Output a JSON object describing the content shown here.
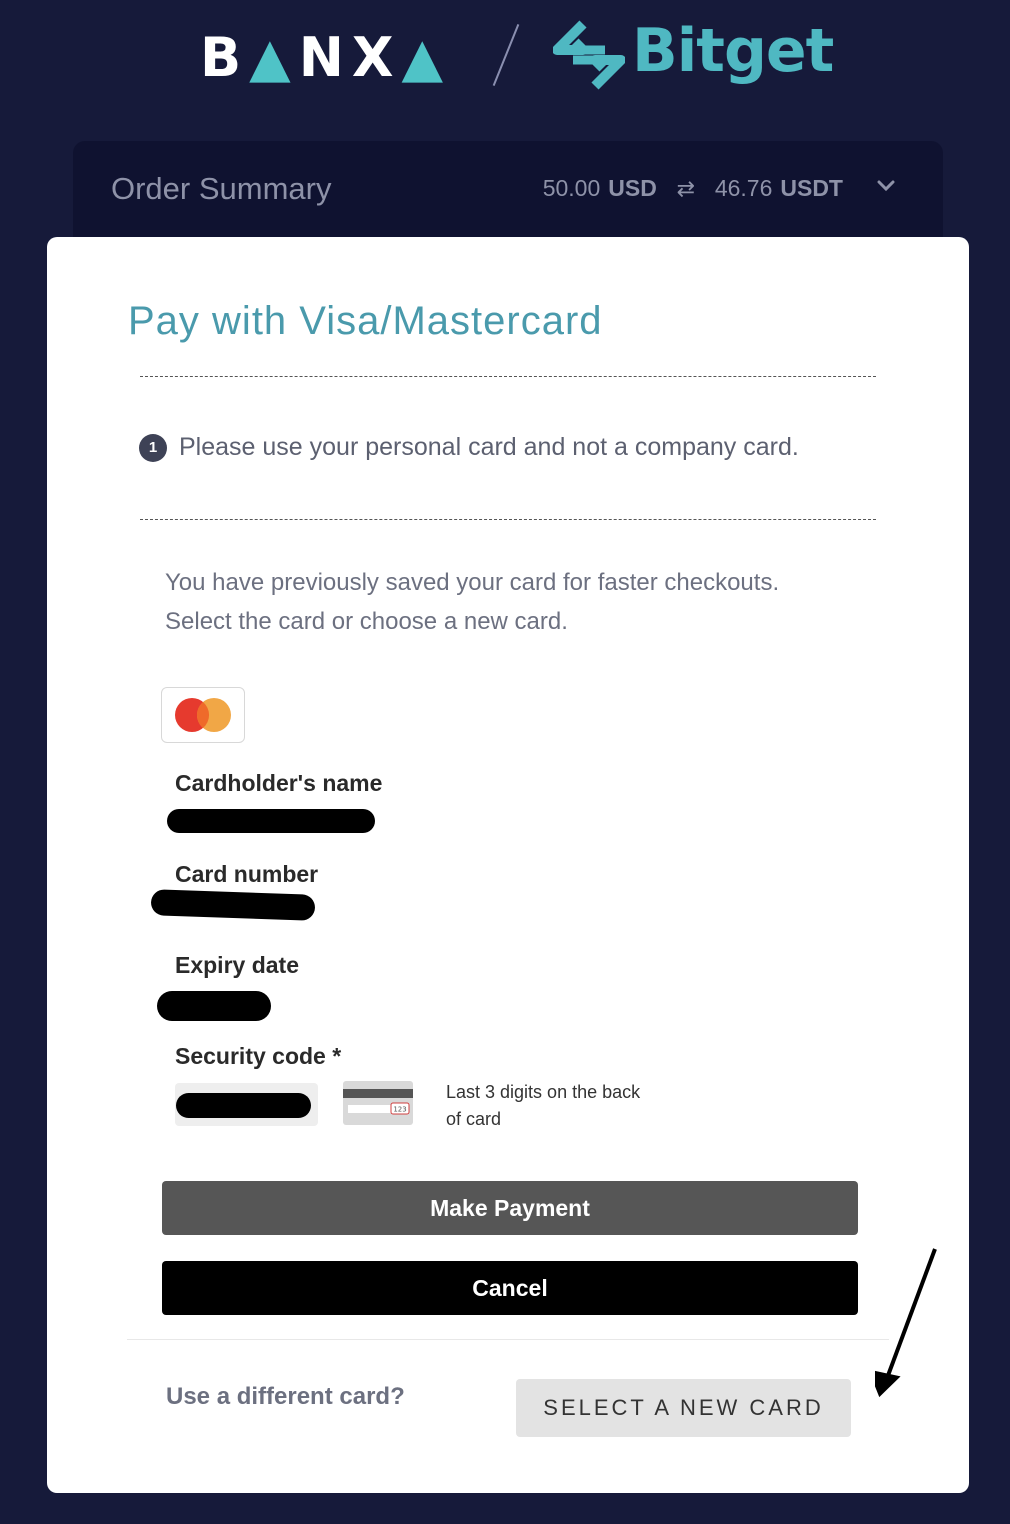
{
  "header": {
    "banxa_logo": "BANXA",
    "bitget_logo": "Bitget"
  },
  "summary": {
    "title": "Order Summary",
    "fiat_amount": "50.00",
    "fiat_currency": "USD",
    "crypto_amount": "46.76",
    "crypto_currency": "USDT"
  },
  "payment": {
    "heading": "Pay with Visa/Mastercard",
    "notice_number": "1",
    "notice": "Please use your personal card and not a company card.",
    "saved_line1": "You have previously saved your card for faster checkouts.",
    "saved_line2": "Select the card or choose a new card.",
    "card_brand_icon": "mastercard-icon",
    "cardholder_label": "Cardholder's name",
    "card_number_label": "Card number",
    "expiry_label": "Expiry date",
    "security_label": "Security code *",
    "security_help": "Last 3 digits on the back of card",
    "cvv_sample": "123",
    "make_payment": "Make Payment",
    "cancel": "Cancel",
    "different_card": "Use a different card?",
    "select_new": "SELECT A NEW CARD"
  },
  "colors": {
    "page_bg": "#161a3a",
    "accent": "#4a9aac",
    "pay_button": "#565656"
  }
}
